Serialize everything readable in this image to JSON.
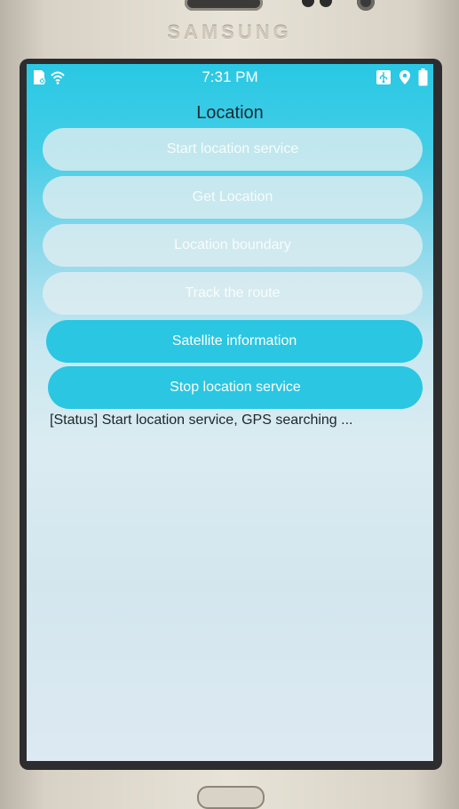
{
  "device": {
    "brand": "SAMSUNG"
  },
  "status_bar": {
    "time": "7:31 PM",
    "left_icons": [
      "sim-card-icon",
      "wifi-icon"
    ],
    "right_icons": [
      "usb-icon",
      "location-pin-icon",
      "battery-icon"
    ]
  },
  "app": {
    "title": "Location"
  },
  "buttons": [
    {
      "label": "Start location service",
      "enabled": false
    },
    {
      "label": "Get Location",
      "enabled": false
    },
    {
      "label": "Location boundary",
      "enabled": false
    },
    {
      "label": "Track the route",
      "enabled": false
    },
    {
      "label": "Satellite information",
      "enabled": true
    },
    {
      "label": "Stop location service",
      "enabled": true
    }
  ],
  "status_message": "[Status] Start location service, GPS searching ...",
  "colors": {
    "accent": "#2ac6e2",
    "screen_top": "#29c8e4",
    "text": "#1f2529"
  }
}
